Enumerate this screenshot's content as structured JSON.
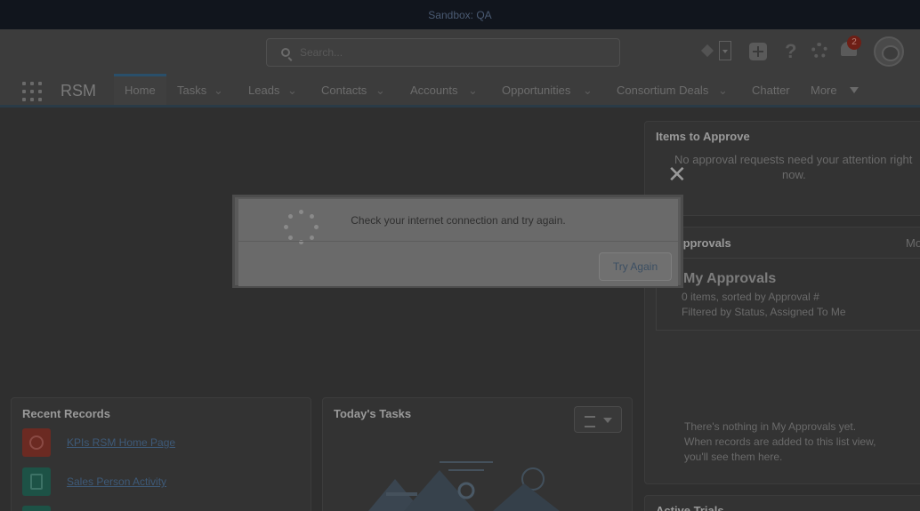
{
  "banner": {
    "text": "Sandbox: QA"
  },
  "header": {
    "search_placeholder": "Search...",
    "notification_count": "2"
  },
  "nav": {
    "app_name": "RSM",
    "tabs": [
      {
        "label": "Home",
        "has_menu": false
      },
      {
        "label": "Tasks",
        "has_menu": true
      },
      {
        "label": "Leads",
        "has_menu": true
      },
      {
        "label": "Contacts",
        "has_menu": true
      },
      {
        "label": "Accounts",
        "has_menu": true
      },
      {
        "label": "Opportunities",
        "has_menu": true
      },
      {
        "label": "Consortium Deals",
        "has_menu": true
      },
      {
        "label": "Chatter",
        "has_menu": false
      },
      {
        "label": "More",
        "has_menu": true
      }
    ]
  },
  "items_to_approve": {
    "title": "Items to Approve",
    "empty_line1": "No approval requests need your attention right",
    "empty_line2": "now."
  },
  "my_approvals": {
    "card_title": "My Approvals",
    "more_label": "Mo",
    "list_title": "My Approvals",
    "meta1": "0 items, sorted by Approval #",
    "meta2": "Filtered by Status, Assigned To Me",
    "empty_line1": "There's nothing in My Approvals yet.",
    "empty_line2": "When records are added to this list view,",
    "empty_line3": "you'll see them here."
  },
  "recent_records": {
    "title": "Recent Records",
    "items": [
      {
        "label": "KPIs RSM Home Page",
        "icon": "dashboard-icon",
        "color": "#7a2a20"
      },
      {
        "label": "Sales Person Activity",
        "icon": "report-icon",
        "color": "#1d5a4c"
      }
    ]
  },
  "todays_tasks": {
    "title": "Today's Tasks"
  },
  "bottom_card": {
    "title": "Active Trials"
  },
  "modal": {
    "message": "Check your internet connection and try again.",
    "button_label": "Try Again",
    "close_symbol": "✕"
  }
}
